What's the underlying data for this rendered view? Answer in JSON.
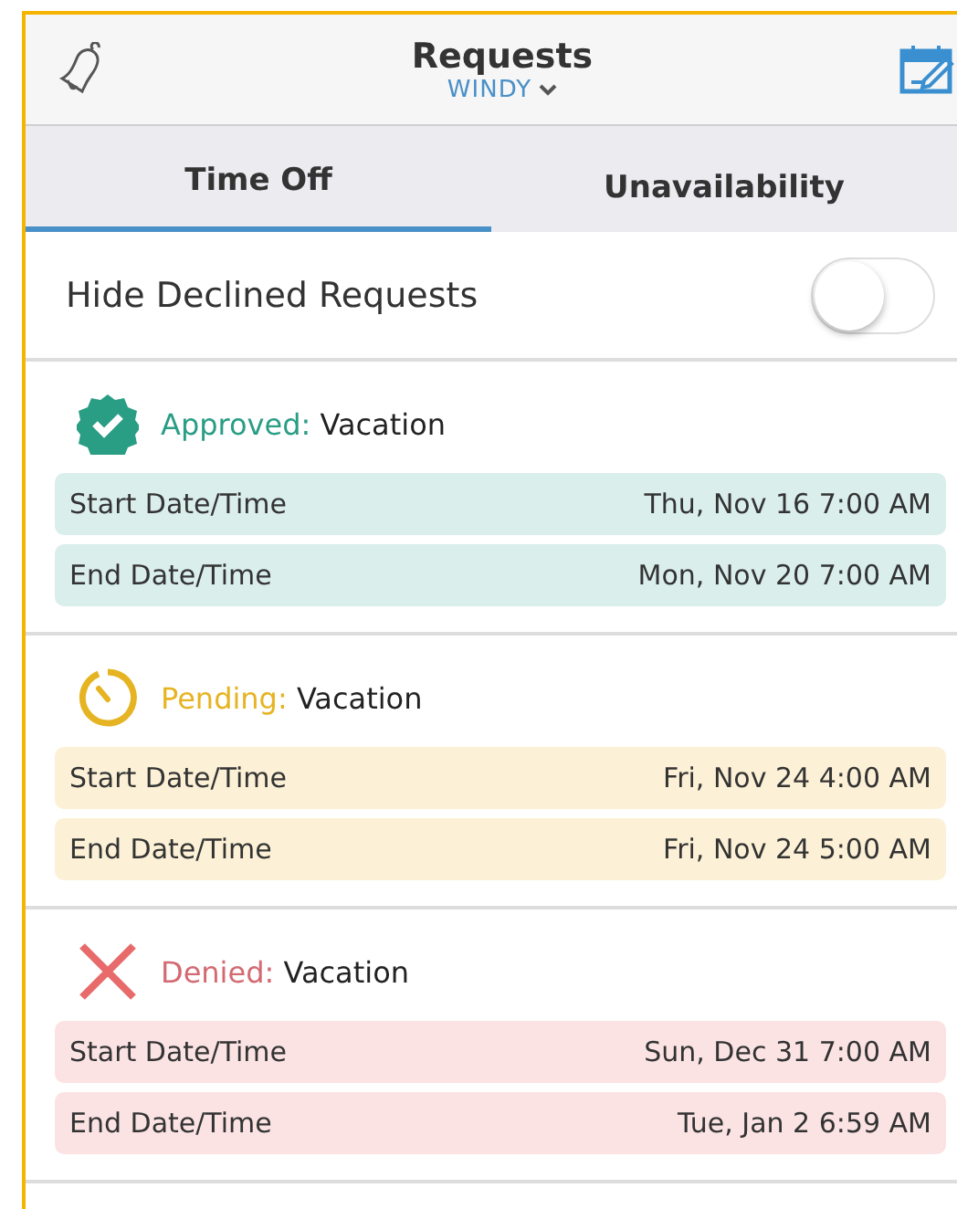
{
  "header": {
    "title": "Requests",
    "subtitle": "WINDY"
  },
  "tabs": [
    {
      "label": "Time Off",
      "selected": true
    },
    {
      "label": "Unavailability",
      "selected": false
    }
  ],
  "toggle": {
    "label": "Hide Declined Requests",
    "on": false
  },
  "requests": [
    {
      "kind": "approved",
      "status": "Approved:",
      "type": "Vacation",
      "rows": [
        {
          "label": "Start Date/Time",
          "value": "Thu, Nov 16 7:00 AM"
        },
        {
          "label": "End Date/Time",
          "value": "Mon, Nov 20 7:00 AM"
        }
      ]
    },
    {
      "kind": "pending",
      "status": "Pending:",
      "type": "Vacation",
      "rows": [
        {
          "label": "Start Date/Time",
          "value": "Fri, Nov 24 4:00 AM"
        },
        {
          "label": "End Date/Time",
          "value": "Fri, Nov 24 5:00 AM"
        }
      ]
    },
    {
      "kind": "denied",
      "status": "Denied:",
      "type": "Vacation",
      "rows": [
        {
          "label": "Start Date/Time",
          "value": "Sun, Dec 31 7:00 AM"
        },
        {
          "label": "End Date/Time",
          "value": "Tue, Jan 2 6:59 AM"
        }
      ]
    }
  ]
}
